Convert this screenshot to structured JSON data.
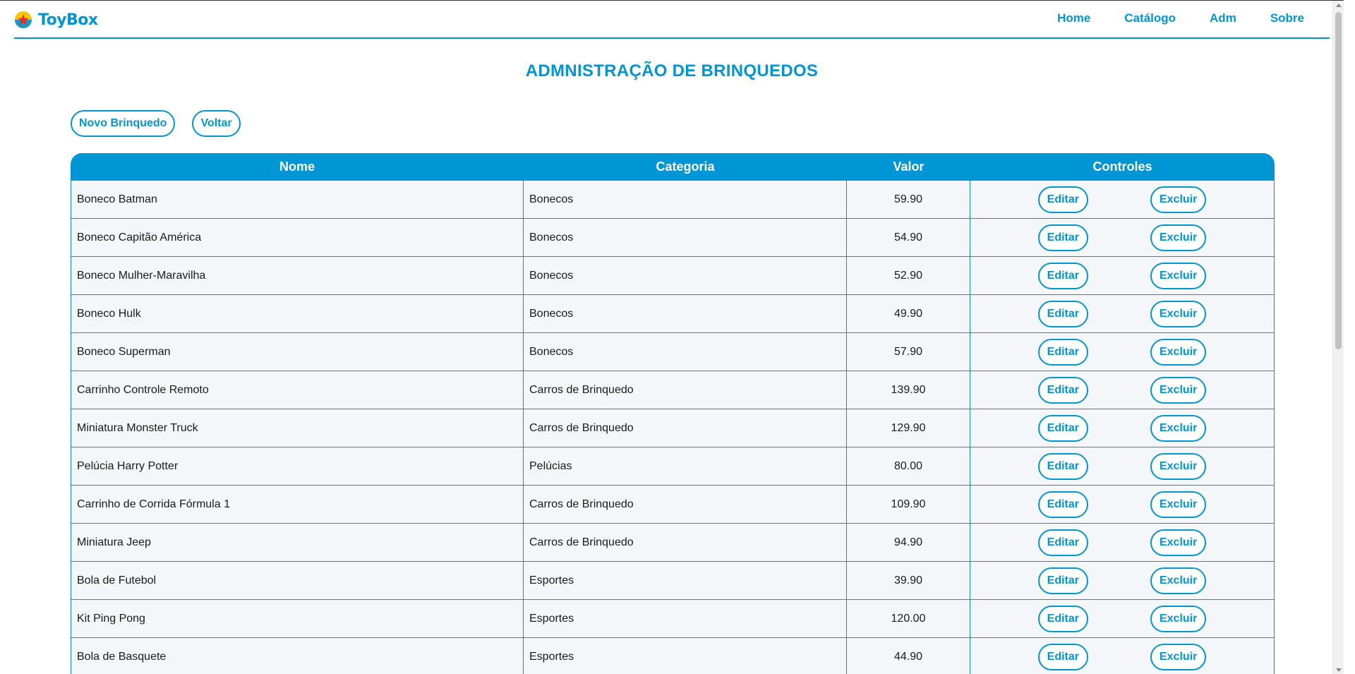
{
  "brand": {
    "name": "ToyBox",
    "logo_icon": "star-ball-icon",
    "color": "#0096d6"
  },
  "nav": {
    "items": [
      {
        "label": "Home"
      },
      {
        "label": "Catálogo"
      },
      {
        "label": "Adm"
      },
      {
        "label": "Sobre"
      }
    ]
  },
  "page": {
    "title": "ADMNISTRAÇÃO DE BRINQUEDOS"
  },
  "actions": {
    "new_label": "Novo Brinquedo",
    "back_label": "Voltar"
  },
  "table": {
    "headers": {
      "nome": "Nome",
      "categoria": "Categoria",
      "valor": "Valor",
      "controles": "Controles"
    },
    "edit_label": "Editar",
    "delete_label": "Excluir",
    "rows": [
      {
        "nome": "Boneco Batman",
        "categoria": "Bonecos",
        "valor": "59.90"
      },
      {
        "nome": "Boneco Capitão América",
        "categoria": "Bonecos",
        "valor": "54.90"
      },
      {
        "nome": "Boneco Mulher-Maravilha",
        "categoria": "Bonecos",
        "valor": "52.90"
      },
      {
        "nome": "Boneco Hulk",
        "categoria": "Bonecos",
        "valor": "49.90"
      },
      {
        "nome": "Boneco Superman",
        "categoria": "Bonecos",
        "valor": "57.90"
      },
      {
        "nome": "Carrinho Controle Remoto",
        "categoria": "Carros de Brinquedo",
        "valor": "139.90"
      },
      {
        "nome": "Miniatura Monster Truck",
        "categoria": "Carros de Brinquedo",
        "valor": "129.90"
      },
      {
        "nome": "Pelúcia Harry Potter",
        "categoria": "Pelúcias",
        "valor": "80.00"
      },
      {
        "nome": "Carrinho de Corrida Fórmula 1",
        "categoria": "Carros de Brinquedo",
        "valor": "109.90"
      },
      {
        "nome": "Miniatura Jeep",
        "categoria": "Carros de Brinquedo",
        "valor": "94.90"
      },
      {
        "nome": "Bola de Futebol",
        "categoria": "Esportes",
        "valor": "39.90"
      },
      {
        "nome": "Kit Ping Pong",
        "categoria": "Esportes",
        "valor": "120.00"
      },
      {
        "nome": "Bola de Basquete",
        "categoria": "Esportes",
        "valor": "44.90"
      }
    ]
  }
}
